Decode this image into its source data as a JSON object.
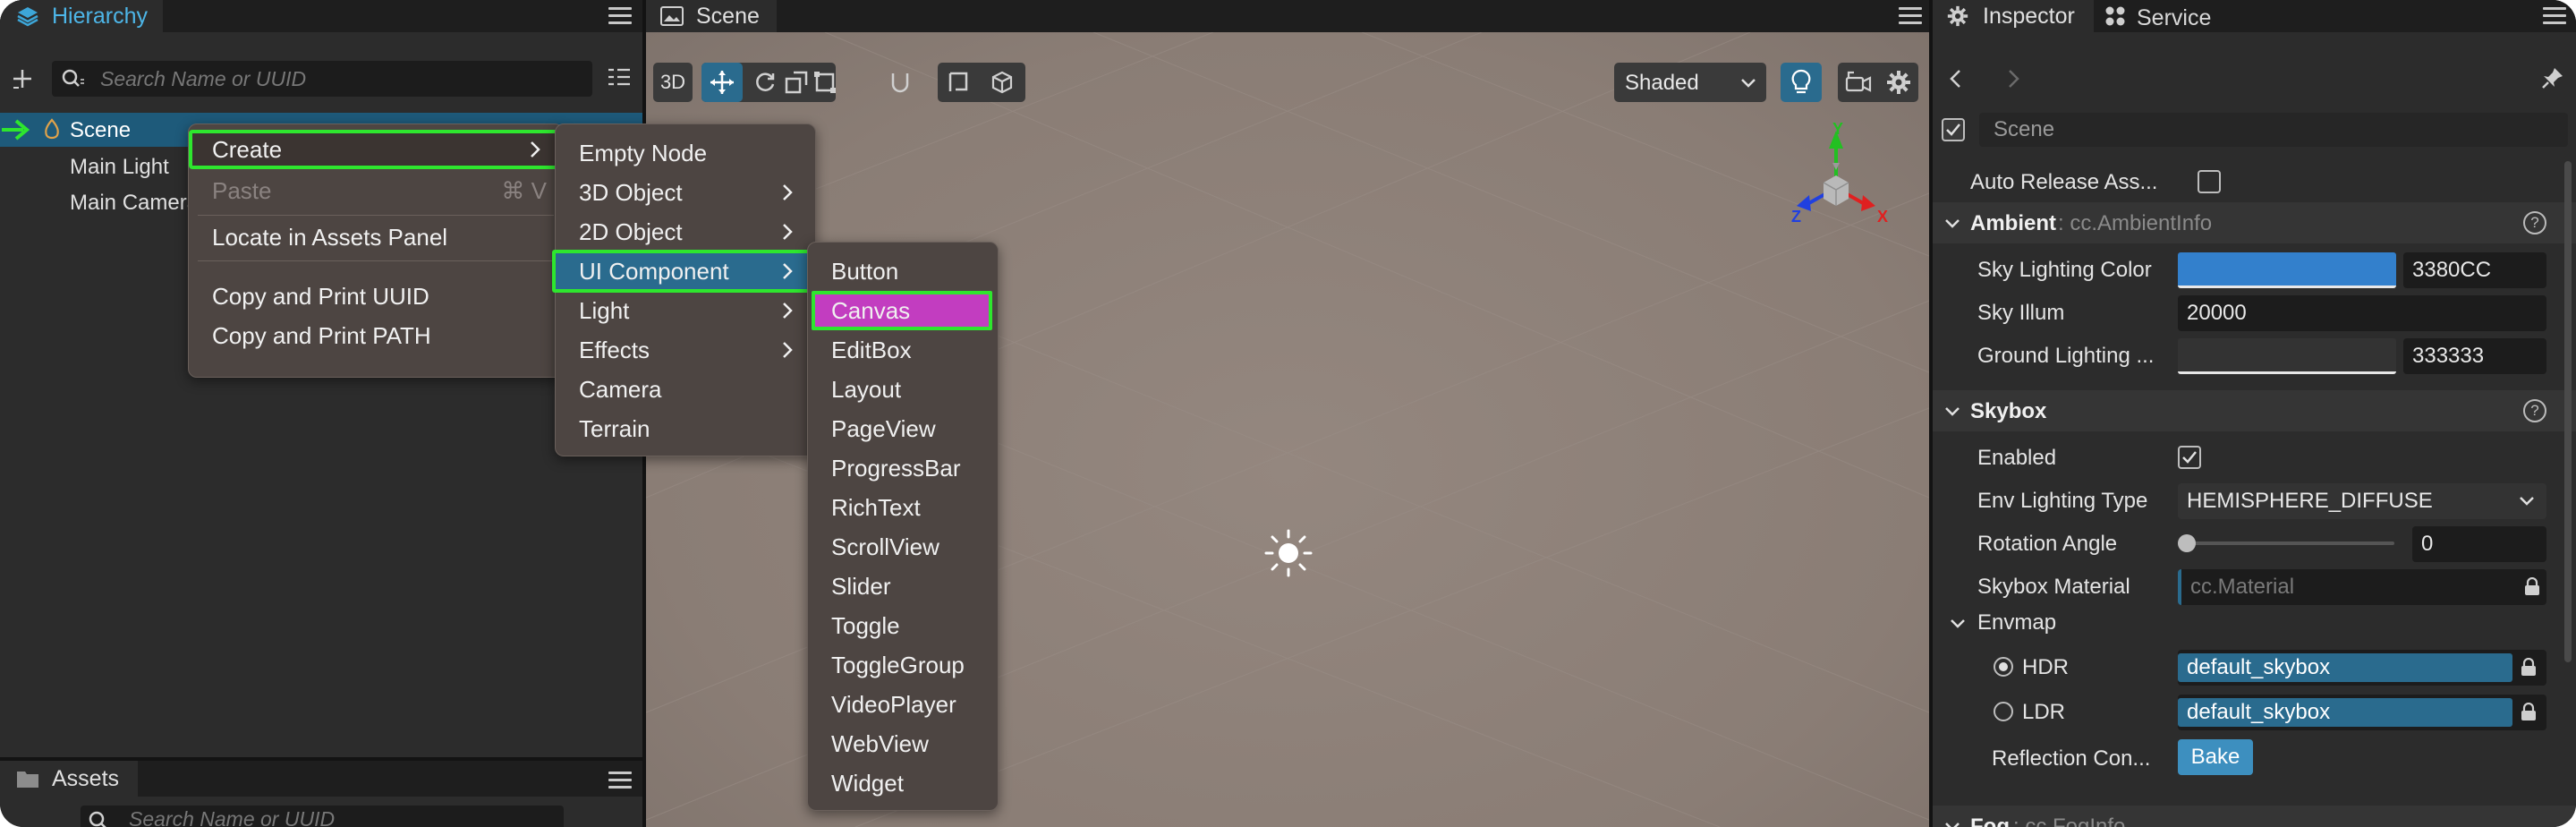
{
  "hierarchy": {
    "tab_label": "Hierarchy",
    "search_placeholder": "Search Name or UUID",
    "nodes": [
      "Scene",
      "Main Light",
      "Main Camera"
    ]
  },
  "context_menu": {
    "items": [
      {
        "label": "Create",
        "shortcut": ""
      },
      {
        "label": "Paste",
        "shortcut": "⌘ V"
      },
      {
        "label": "Locate in Assets Panel",
        "shortcut": ""
      },
      {
        "label": "Copy and Print UUID",
        "shortcut": ""
      },
      {
        "label": "Copy and Print PATH",
        "shortcut": ""
      }
    ]
  },
  "create_submenu": {
    "items": [
      "Empty Node",
      "3D Object",
      "2D Object",
      "UI Component",
      "Light",
      "Effects",
      "Camera",
      "Terrain"
    ]
  },
  "ui_component_submenu": {
    "items": [
      "Button",
      "Canvas",
      "EditBox",
      "Layout",
      "PageView",
      "ProgressBar",
      "RichText",
      "ScrollView",
      "Slider",
      "Toggle",
      "ToggleGroup",
      "VideoPlayer",
      "WebView",
      "Widget"
    ]
  },
  "assets": {
    "tab_label": "Assets",
    "search_placeholder": "Search Name or UUID"
  },
  "scene": {
    "tab_label": "Scene",
    "mode_3d": "3D",
    "shading": "Shaded",
    "gizmo_axes": {
      "x": "X",
      "y": "Y",
      "z": "Z"
    }
  },
  "inspector": {
    "tab_label": "Inspector",
    "service_tab_label": "Service",
    "node_name": "Scene",
    "auto_release_label": "Auto Release Ass...",
    "ambient": {
      "title": "Ambient",
      "type": ": cc.AmbientInfo",
      "sky_lighting_color_label": "Sky Lighting Color",
      "sky_lighting_color_hex": "3380CC",
      "sky_illum_label": "Sky Illum",
      "sky_illum_value": "20000",
      "ground_lighting_label": "Ground Lighting ...",
      "ground_lighting_hex": "333333"
    },
    "skybox": {
      "title": "Skybox",
      "enabled_label": "Enabled",
      "env_lighting_type_label": "Env Lighting Type",
      "env_lighting_type_value": "HEMISPHERE_DIFFUSE",
      "rotation_angle_label": "Rotation Angle",
      "rotation_angle_value": "0",
      "skybox_material_label": "Skybox Material",
      "skybox_material_value": "cc.Material",
      "envmap_label": "Envmap",
      "hdr_label": "HDR",
      "hdr_value": "default_skybox",
      "ldr_label": "LDR",
      "ldr_value": "default_skybox",
      "reflection_label": "Reflection Con...",
      "bake_label": "Bake"
    },
    "fog_partial": "Fog",
    "fog_type_partial": ": cc.FogInfo"
  },
  "colors": {
    "highlight_green": "#2EE62E",
    "canvas_highlight": "#C23DC0",
    "sky_color": "#3380CC",
    "ground_color": "#333333",
    "accent_blue": "#2A6B8E",
    "gizmo_x": "#E02020",
    "gizmo_y": "#22C022",
    "gizmo_z": "#2040E0"
  }
}
